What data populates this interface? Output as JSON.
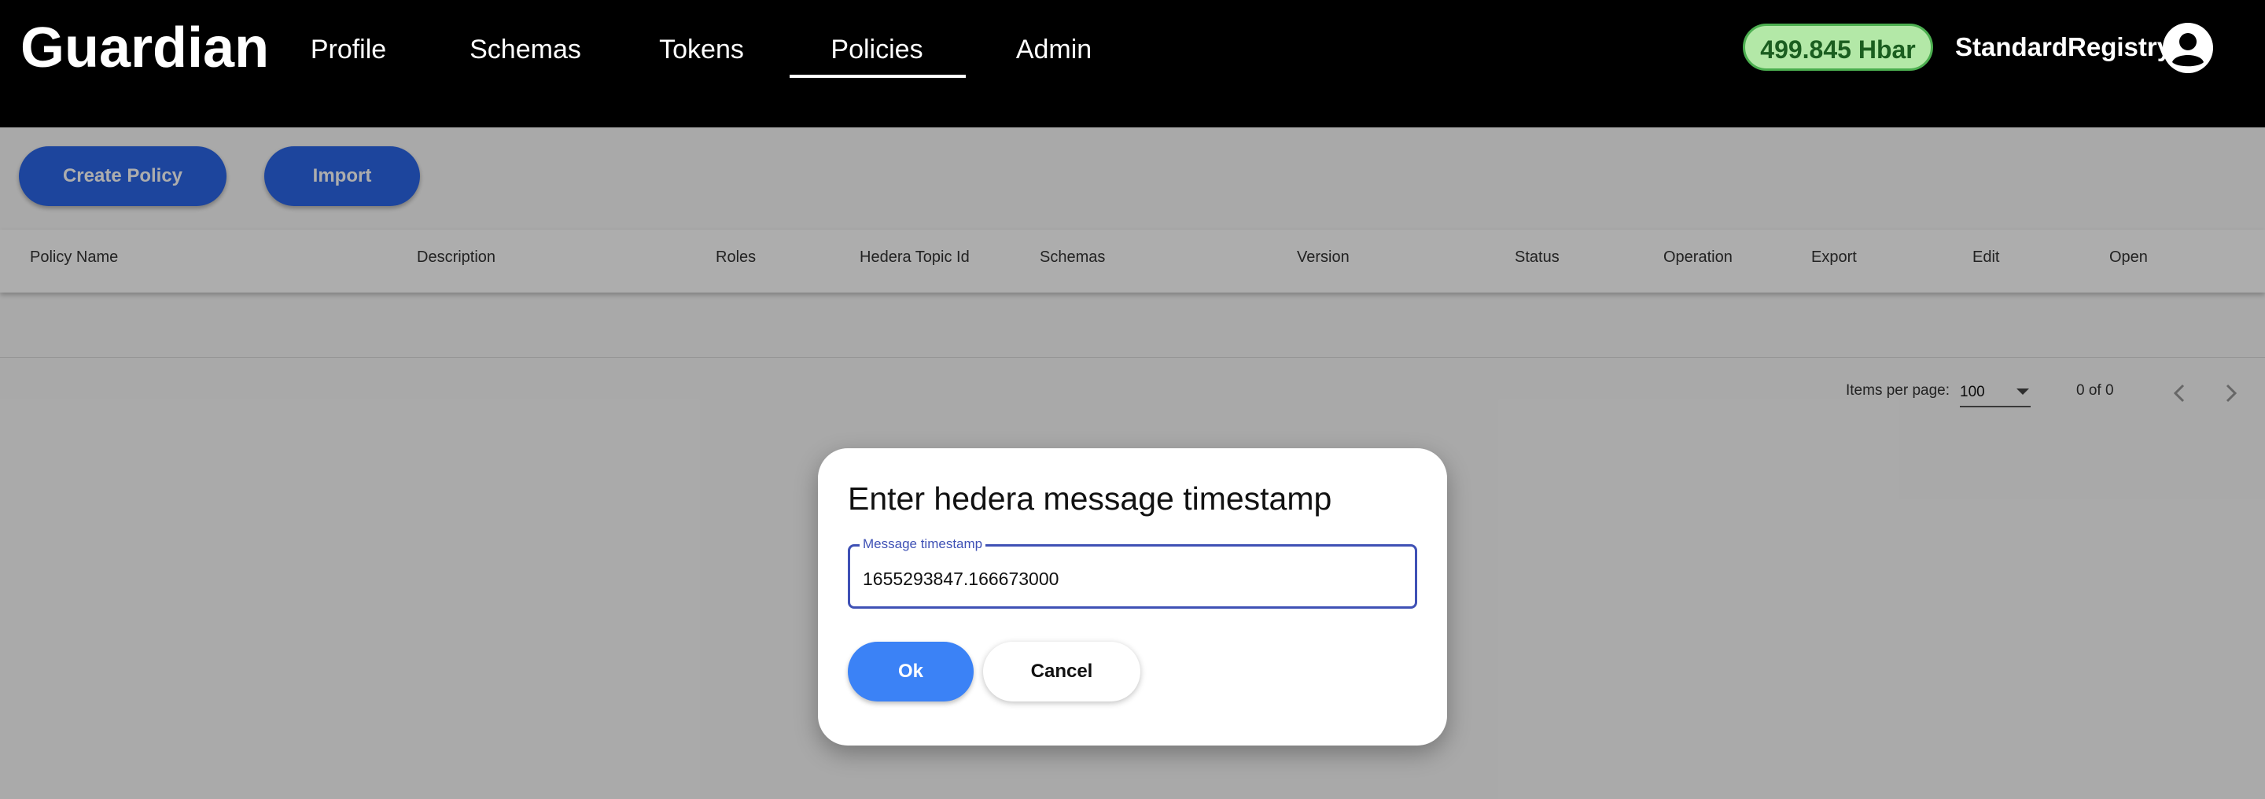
{
  "header": {
    "logo": "Guardian",
    "nav": [
      {
        "label": "Profile"
      },
      {
        "label": "Schemas"
      },
      {
        "label": "Tokens"
      },
      {
        "label": "Policies",
        "active": true
      },
      {
        "label": "Admin"
      }
    ],
    "balance": "499.845 Hbar",
    "username": "StandardRegistry",
    "avatar_icon": "account-circle-icon"
  },
  "toolbar": {
    "create_label": "Create Policy",
    "import_label": "Import"
  },
  "table": {
    "columns": [
      "Policy Name",
      "Description",
      "Roles",
      "Hedera Topic Id",
      "Schemas",
      "Version",
      "Status",
      "Operation",
      "Export",
      "Edit",
      "Open"
    ],
    "rows": []
  },
  "paginator": {
    "items_per_page_label": "Items per page:",
    "page_size": "100",
    "range": "0 of 0"
  },
  "dialog": {
    "title": "Enter hedera message timestamp",
    "field_label": "Message timestamp",
    "field_value": "1655293847.166673000",
    "ok_label": "Ok",
    "cancel_label": "Cancel"
  },
  "colors": {
    "header_bg": "#000000",
    "primary": "#2c66e8",
    "ok_button": "#3b82f6",
    "balance_bg": "#b3e8a7",
    "balance_border": "#4caf50",
    "field_border": "#3f51b5"
  }
}
